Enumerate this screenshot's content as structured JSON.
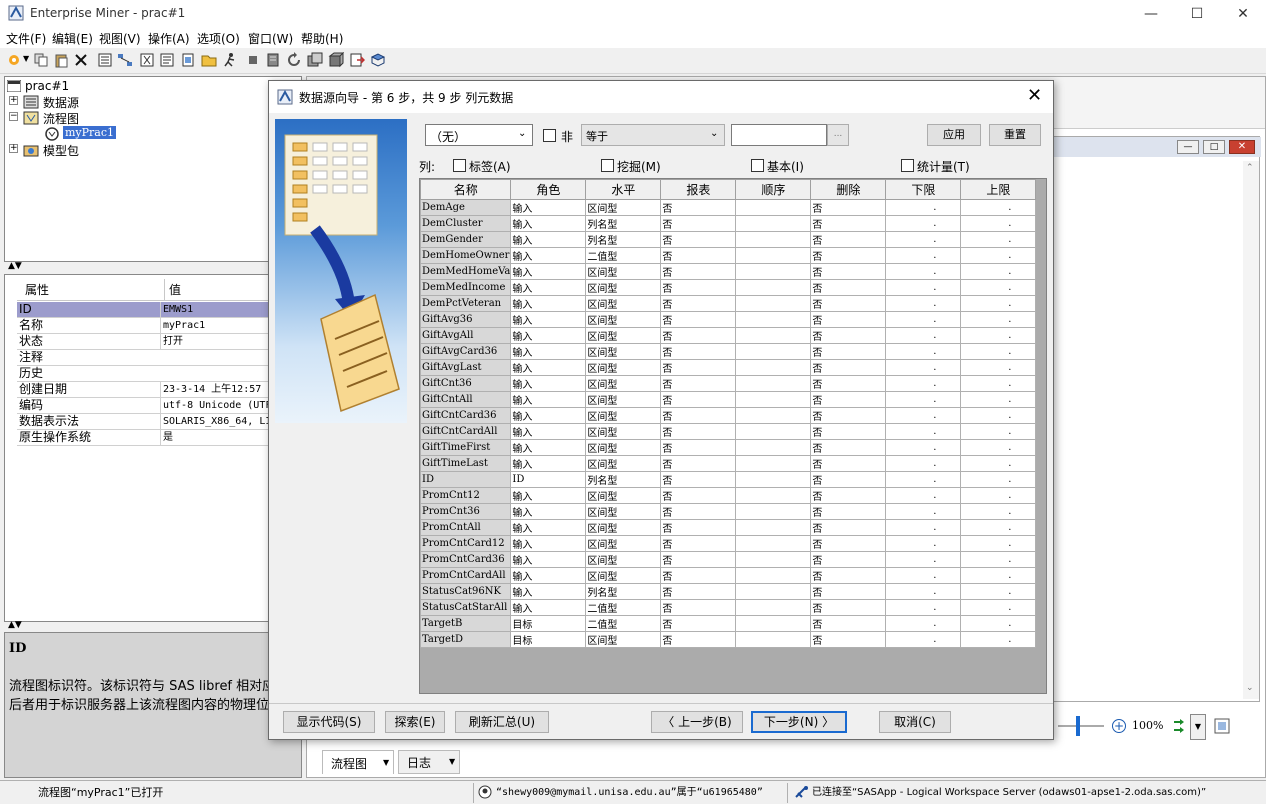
{
  "window": {
    "title": "Enterprise Miner - prac#1"
  },
  "menu": [
    "文件(F)",
    "编辑(E)",
    "视图(V)",
    "操作(A)",
    "选项(O)",
    "窗口(W)",
    "帮助(H)"
  ],
  "tree": {
    "root": "prac#1",
    "items": [
      "数据源",
      "流程图",
      "myPrac1",
      "模型包"
    ]
  },
  "props": {
    "header_key": "属性",
    "header_val": "值",
    "rows": [
      {
        "k": "ID",
        "v": "EMWS1"
      },
      {
        "k": "名称",
        "v": "myPrac1"
      },
      {
        "k": "状态",
        "v": "打开"
      },
      {
        "k": "注释",
        "v": ""
      },
      {
        "k": "历史",
        "v": ""
      },
      {
        "k": "创建日期",
        "v": "23-3-14 上午12:57"
      },
      {
        "k": "编码",
        "v": "utf-8  Unicode (UTF"
      },
      {
        "k": "数据表示法",
        "v": "SOLARIS_X86_64, LI"
      },
      {
        "k": "原生操作系统",
        "v": "是"
      }
    ]
  },
  "desc": {
    "title": "ID",
    "text": "流程图标识符。该标识符与 SAS libref 相对应，后者用于标识服务器上该流程图内容的物理位置。"
  },
  "dialog": {
    "title": "数据源向导 - 第 6 步，共 9 步 列元数据",
    "filter_select": "（无）",
    "not_label": "非",
    "op_select": "等于",
    "apply": "应用",
    "reset": "重置",
    "cols_label": "列:",
    "checks": [
      "标签(A)",
      "挖掘(M)",
      "基本(I)",
      "统计量(T)"
    ],
    "headers": [
      "名称",
      "角色",
      "水平",
      "报表",
      "顺序",
      "删除",
      "下限",
      "上限"
    ],
    "rows": [
      [
        "DemAge",
        "输入",
        "区间型",
        "否",
        "",
        "否"
      ],
      [
        "DemCluster",
        "输入",
        "列名型",
        "否",
        "",
        "否"
      ],
      [
        "DemGender",
        "输入",
        "列名型",
        "否",
        "",
        "否"
      ],
      [
        "DemHomeOwner",
        "输入",
        "二值型",
        "否",
        "",
        "否"
      ],
      [
        "DemMedHomeVa",
        "输入",
        "区间型",
        "否",
        "",
        "否"
      ],
      [
        "DemMedIncome",
        "输入",
        "区间型",
        "否",
        "",
        "否"
      ],
      [
        "DemPctVeteran",
        "输入",
        "区间型",
        "否",
        "",
        "否"
      ],
      [
        "GiftAvg36",
        "输入",
        "区间型",
        "否",
        "",
        "否"
      ],
      [
        "GiftAvgAll",
        "输入",
        "区间型",
        "否",
        "",
        "否"
      ],
      [
        "GiftAvgCard36",
        "输入",
        "区间型",
        "否",
        "",
        "否"
      ],
      [
        "GiftAvgLast",
        "输入",
        "区间型",
        "否",
        "",
        "否"
      ],
      [
        "GiftCnt36",
        "输入",
        "区间型",
        "否",
        "",
        "否"
      ],
      [
        "GiftCntAll",
        "输入",
        "区间型",
        "否",
        "",
        "否"
      ],
      [
        "GiftCntCard36",
        "输入",
        "区间型",
        "否",
        "",
        "否"
      ],
      [
        "GiftCntCardAll",
        "输入",
        "区间型",
        "否",
        "",
        "否"
      ],
      [
        "GiftTimeFirst",
        "输入",
        "区间型",
        "否",
        "",
        "否"
      ],
      [
        "GiftTimeLast",
        "输入",
        "区间型",
        "否",
        "",
        "否"
      ],
      [
        "ID",
        "ID",
        "列名型",
        "否",
        "",
        "否"
      ],
      [
        "PromCnt12",
        "输入",
        "区间型",
        "否",
        "",
        "否"
      ],
      [
        "PromCnt36",
        "输入",
        "区间型",
        "否",
        "",
        "否"
      ],
      [
        "PromCntAll",
        "输入",
        "区间型",
        "否",
        "",
        "否"
      ],
      [
        "PromCntCard12",
        "输入",
        "区间型",
        "否",
        "",
        "否"
      ],
      [
        "PromCntCard36",
        "输入",
        "区间型",
        "否",
        "",
        "否"
      ],
      [
        "PromCntCardAll",
        "输入",
        "区间型",
        "否",
        "",
        "否"
      ],
      [
        "StatusCat96NK",
        "输入",
        "列名型",
        "否",
        "",
        "否"
      ],
      [
        "StatusCatStarAll",
        "输入",
        "二值型",
        "否",
        "",
        "否"
      ],
      [
        "TargetB",
        "目标",
        "二值型",
        "否",
        "",
        "否"
      ],
      [
        "TargetD",
        "目标",
        "区间型",
        "否",
        "",
        "否"
      ]
    ],
    "buttons": {
      "show_code": "显示代码(S)",
      "explore": "探索(E)",
      "refresh": "刷新汇总(U)",
      "back": "〈 上一步(B)",
      "next": "下一步(N) 〉",
      "cancel": "取消(C)"
    }
  },
  "bottom_tabs": [
    "流程图",
    "日志"
  ],
  "zoom": "100%",
  "status": {
    "left": "流程图“myPrac1”已打开",
    "user": "“shewy009@mymail.unisa.edu.au”属于“u61965480”",
    "conn": "已连接至“SASApp - Logical Workspace Server (odaws01-apse1-2.oda.sas.com)”"
  }
}
